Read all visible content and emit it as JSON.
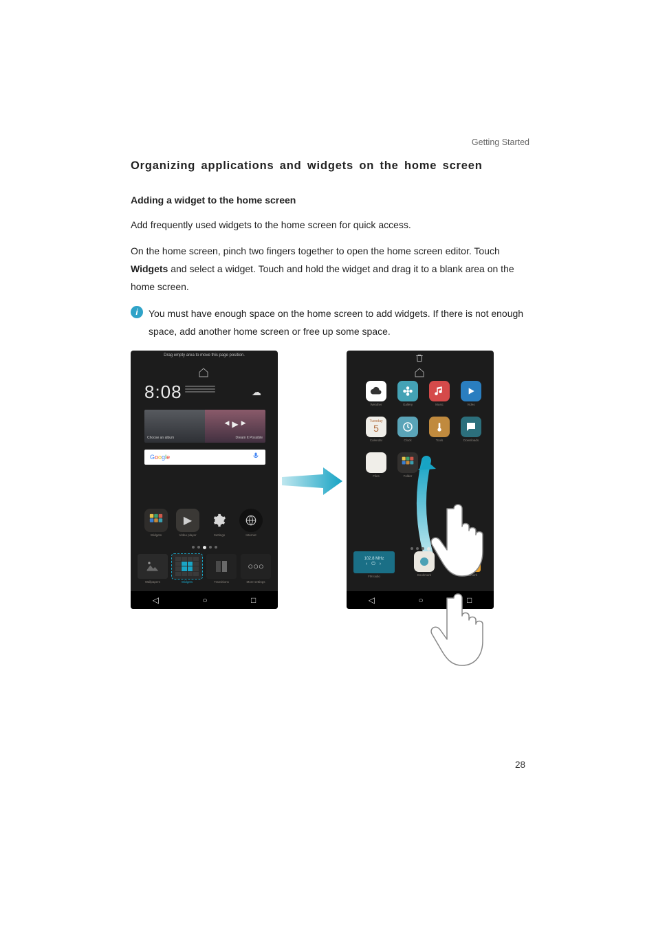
{
  "running_head": "Getting Started",
  "section_title": "Organizing applications and widgets on the home screen",
  "subsection_title": "Adding a widget to the home screen",
  "body1": "Add frequently used widgets to the home screen for quick access.",
  "body2_a": "On the home screen, pinch two fingers together to open the home screen editor. Touch ",
  "body2_bold": "Widgets",
  "body2_b": " and select a widget. Touch and hold the widget and drag it to a blank area on the home screen.",
  "note_text": "You must have enough space on the home screen to add widgets. If there is not enough space, add another home screen or free up some space.",
  "page_number": "28",
  "left_phone": {
    "top_hint": "Drag empty area to move this page position.",
    "clock_time": "8:08",
    "gallery_left_caption": "Choose an album",
    "gallery_right_caption": "Dream It Possible",
    "google_label": "Google",
    "app_row": [
      {
        "name": "folder",
        "cap": "Widgets"
      },
      {
        "name": "play",
        "cap": "Video player"
      },
      {
        "name": "gear",
        "cap": "Settings"
      },
      {
        "name": "browser",
        "cap": "Internet"
      }
    ],
    "widget_bar": [
      {
        "cap": "Wallpapers"
      },
      {
        "cap": "Widgets"
      },
      {
        "cap": "Transitions"
      },
      {
        "cap": "More settings"
      }
    ]
  },
  "right_phone": {
    "grid": [
      {
        "bg": "#ffffff",
        "fg": "#333",
        "glyph": "cloud",
        "cap": "Weather"
      },
      {
        "bg": "#44a2b5",
        "fg": "#fff",
        "glyph": "flower",
        "cap": "Gallery"
      },
      {
        "bg": "#d54a4a",
        "fg": "#fff",
        "glyph": "music",
        "cap": "Music"
      },
      {
        "bg": "#2a7ec0",
        "fg": "#fff",
        "glyph": "play",
        "cap": "Video"
      },
      {
        "bg": "#f0eee9",
        "fg": "#c05a2a",
        "glyph": "cal5",
        "cap": "Calendar"
      },
      {
        "bg": "#5aa4b8",
        "fg": "#fff",
        "glyph": "clock",
        "cap": "Clock"
      },
      {
        "bg": "#c08a3e",
        "fg": "#fff",
        "glyph": "thermo",
        "cap": "Tools"
      },
      {
        "bg": "#2c6f7c",
        "fg": "#fff",
        "glyph": "msg",
        "cap": "Downloads"
      },
      {
        "bg": "#f0eee9",
        "fg": "#888",
        "glyph": "blank",
        "cap": "Files"
      },
      {
        "bg": "#32302e",
        "fg": "#ddd",
        "glyph": "grid",
        "cap": "Folder"
      }
    ],
    "widget_bar": {
      "fm_label": "102.8 MHz",
      "fm_caption": "FM radio",
      "slot2_caption": "Bookmark",
      "slot3_caption": "Bookmark"
    }
  }
}
